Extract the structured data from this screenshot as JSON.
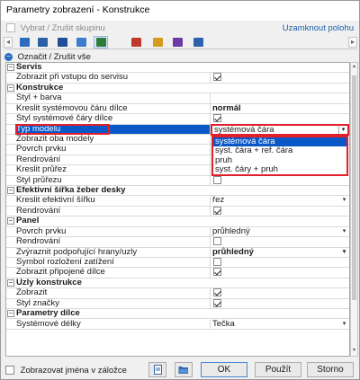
{
  "window": {
    "title": "Parametry zobrazení - Konstrukce"
  },
  "top": {
    "select_group_label": "Vybrat / Zrušit skupinu",
    "lock_position_label": "Uzamknout polohu"
  },
  "toolbar": {
    "tabs": [
      {
        "icon": "structure-icon",
        "color": "#2d6bbf"
      },
      {
        "icon": "grid-view-icon",
        "color": "#2a5fa6"
      },
      {
        "icon": "member-icon",
        "color": "#1f4f98"
      },
      {
        "icon": "dimension-icon",
        "color": "#3c7bd0"
      },
      {
        "icon": "support-icon",
        "color": "#2e7a3c"
      },
      {
        "icon": "load-icon",
        "color": "#c03a2b"
      },
      {
        "icon": "color-palette-icon",
        "color": "#d69a1c"
      },
      {
        "icon": "result-icon",
        "color": "#6b3aa6"
      },
      {
        "icon": "search-icon",
        "color": "#2f62ad"
      }
    ]
  },
  "select_all_label": "Označit / Zrušit vše",
  "rows": [
    {
      "type": "cat",
      "exp": "−",
      "label": "Servis"
    },
    {
      "type": "item",
      "label": "Zobrazit při vstupu do servisu",
      "value_type": "check",
      "checked": true
    },
    {
      "type": "cat",
      "exp": "−",
      "label": "Konstrukce"
    },
    {
      "type": "item",
      "label": "Styl + barva",
      "value_type": "none"
    },
    {
      "type": "item",
      "label": "Kreslit systémovou čáru dílce",
      "value_type": "text",
      "value": "normál",
      "bold": true
    },
    {
      "type": "item",
      "label": "Styl systémové čáry dílce",
      "value_type": "check",
      "checked": true
    },
    {
      "type": "item",
      "label": "Typ modelu",
      "value_type": "combo",
      "value": "systémová čára",
      "selected": true
    },
    {
      "type": "item",
      "label": "Zobrazit oba modely",
      "value_type": "none"
    },
    {
      "type": "item",
      "label": "Povrch prvku",
      "value_type": "none"
    },
    {
      "type": "item",
      "label": "Rendrování",
      "value_type": "none"
    },
    {
      "type": "item",
      "label": "Kreslit průřez",
      "value_type": "text_dd",
      "value": "rendrovaný"
    },
    {
      "type": "item",
      "label": "Styl průřezu",
      "value_type": "check",
      "checked": false
    },
    {
      "type": "cat",
      "exp": "−",
      "label": "Efektivní šířka žeber desky"
    },
    {
      "type": "item",
      "label": "Kreslit efektivní šířku",
      "value_type": "text_dd",
      "value": "řez"
    },
    {
      "type": "item",
      "label": "Rendrování",
      "value_type": "check",
      "checked": true
    },
    {
      "type": "cat",
      "exp": "−",
      "label": "Panel"
    },
    {
      "type": "item",
      "label": "Povrch prvku",
      "value_type": "text_dd",
      "value": "průhledný"
    },
    {
      "type": "item",
      "label": "Rendrování",
      "value_type": "check",
      "checked": false
    },
    {
      "type": "item",
      "label": "Zvýraznit podpořující hrany/uzly",
      "value_type": "text_dd",
      "value": "průhledný",
      "bold": true
    },
    {
      "type": "item",
      "label": "Symbol rozložení zatížení",
      "value_type": "check",
      "checked": false
    },
    {
      "type": "item",
      "label": "Zobrazit připojené dílce",
      "value_type": "check",
      "checked": true
    },
    {
      "type": "cat",
      "exp": "−",
      "label": "Uzly konstrukce"
    },
    {
      "type": "item",
      "label": "Zobrazit",
      "value_type": "check",
      "checked": true
    },
    {
      "type": "item",
      "label": "Styl značky",
      "value_type": "check",
      "checked": true
    },
    {
      "type": "cat",
      "exp": "−",
      "label": "Parametry dílce"
    },
    {
      "type": "item",
      "label": "Systémové délky",
      "value_type": "text_dd",
      "value": "Tečka"
    }
  ],
  "dropdown_options": [
    "systémová čára",
    "syst. čára + ref. čára",
    "pruh",
    "syst. čáry + pruh"
  ],
  "bottom": {
    "show_names_label": "Zobrazovat jména v záložce",
    "ok_label": "OK",
    "apply_label": "Použít",
    "cancel_label": "Storno"
  }
}
